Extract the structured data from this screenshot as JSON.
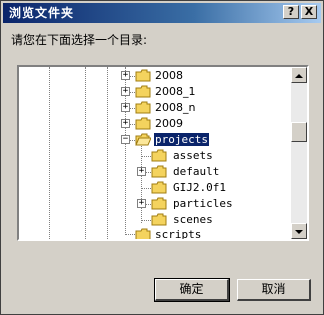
{
  "window": {
    "title": "浏览文件夹",
    "help_label": "?",
    "close_label": "X"
  },
  "prompt": "请您在下面选择一个目录:",
  "tree": {
    "items": [
      {
        "label": "2008",
        "expander": "+",
        "level": 1
      },
      {
        "label": "2008_1",
        "expander": "+",
        "level": 1
      },
      {
        "label": "2008_n",
        "expander": "+",
        "level": 1
      },
      {
        "label": "2009",
        "expander": "+",
        "level": 1
      },
      {
        "label": "projects",
        "expander": "−",
        "level": 1,
        "selected": true
      },
      {
        "label": "assets",
        "expander": "",
        "level": 2
      },
      {
        "label": "default",
        "expander": "+",
        "level": 2
      },
      {
        "label": "GIJ2.0f1",
        "expander": "",
        "level": 2
      },
      {
        "label": "particles",
        "expander": "+",
        "level": 2
      },
      {
        "label": "scenes",
        "expander": "",
        "level": 2
      },
      {
        "label": "scripts",
        "expander": "",
        "level": 1
      }
    ]
  },
  "buttons": {
    "ok": "确定",
    "cancel": "取消"
  },
  "colors": {
    "title_start": "#0a246a",
    "title_end": "#a6caf0",
    "selection": "#0a246a",
    "folder": "#f4d35e"
  }
}
